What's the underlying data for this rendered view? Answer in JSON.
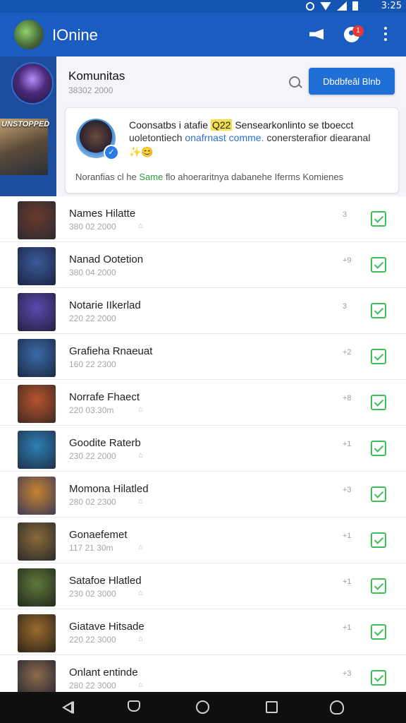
{
  "status_bar": {
    "time": "3:25"
  },
  "app_bar": {
    "title": "IOnine",
    "notification_count": "1"
  },
  "left_strip": {
    "banner_text": "UNSTOPPED"
  },
  "community": {
    "title": "Komunitas",
    "subtitle": "38302 2000",
    "join_button": "Dbdbfeâl Blnb",
    "card": {
      "line1_a": "Coonsatbs i atafie",
      "line1_hl": "Q22",
      "line1_b": "Sensearkonlinto se tboecct",
      "line2_a": "uoletontiech",
      "line2_hl": "onafrnast comme.",
      "line2_b": "conersterafior diearanal",
      "emoji": "✨😊",
      "footer_a": "Noranfias cl he",
      "footer_hl": "Same",
      "footer_b": "flo ahoeraritnya dabanehe Iferms Komienes"
    }
  },
  "members": [
    {
      "name": "Names Hilatte",
      "date": "380 02 2000",
      "count": "3",
      "pinned": true,
      "thumb": [
        "#6b3a2a",
        "#2b2a34"
      ]
    },
    {
      "name": "Nanad Ootetion",
      "date": "380 04 2000",
      "count": "+9",
      "pinned": false,
      "thumb": [
        "#3a5a9a",
        "#1b2340"
      ]
    },
    {
      "name": "Notarie IIkerlad",
      "date": "220 22 2000",
      "count": "3",
      "pinned": false,
      "thumb": [
        "#5a4ab0",
        "#24203f"
      ]
    },
    {
      "name": "Grafieha Rnaeuat",
      "date": "160 22 2300",
      "count": "+2",
      "pinned": false,
      "thumb": [
        "#3b6aa8",
        "#1a2a44"
      ]
    },
    {
      "name": "Norrafe Fhaect",
      "date": "220 03.30m",
      "count": "+8",
      "pinned": true,
      "thumb": [
        "#b8532e",
        "#3e2a22"
      ]
    },
    {
      "name": "Goodite Raterb",
      "date": "230 22 2000",
      "count": "+1",
      "pinned": true,
      "thumb": [
        "#2d7fb6",
        "#1f3048"
      ]
    },
    {
      "name": "Momona Hilatled",
      "date": "280 02 2300",
      "count": "+3",
      "pinned": true,
      "thumb": [
        "#c7832e",
        "#3e3a58"
      ]
    },
    {
      "name": "Gonaefemet",
      "date": "117 21 30m",
      "count": "+1",
      "pinned": true,
      "thumb": [
        "#8a6a3a",
        "#2a2a2a"
      ]
    },
    {
      "name": "Satafoe Hlatled",
      "date": "230 02 3000",
      "count": "+1",
      "pinned": true,
      "thumb": [
        "#5e7a3a",
        "#23281c"
      ]
    },
    {
      "name": "Giatave Hitsade",
      "date": "220 22 3000",
      "count": "+1",
      "pinned": true,
      "thumb": [
        "#9a6a2e",
        "#2d2418"
      ]
    },
    {
      "name": "Onlant entinde",
      "date": "280 22 3000",
      "count": "+3",
      "pinned": true,
      "thumb": [
        "#8e6a4a",
        "#1f2430"
      ]
    }
  ]
}
